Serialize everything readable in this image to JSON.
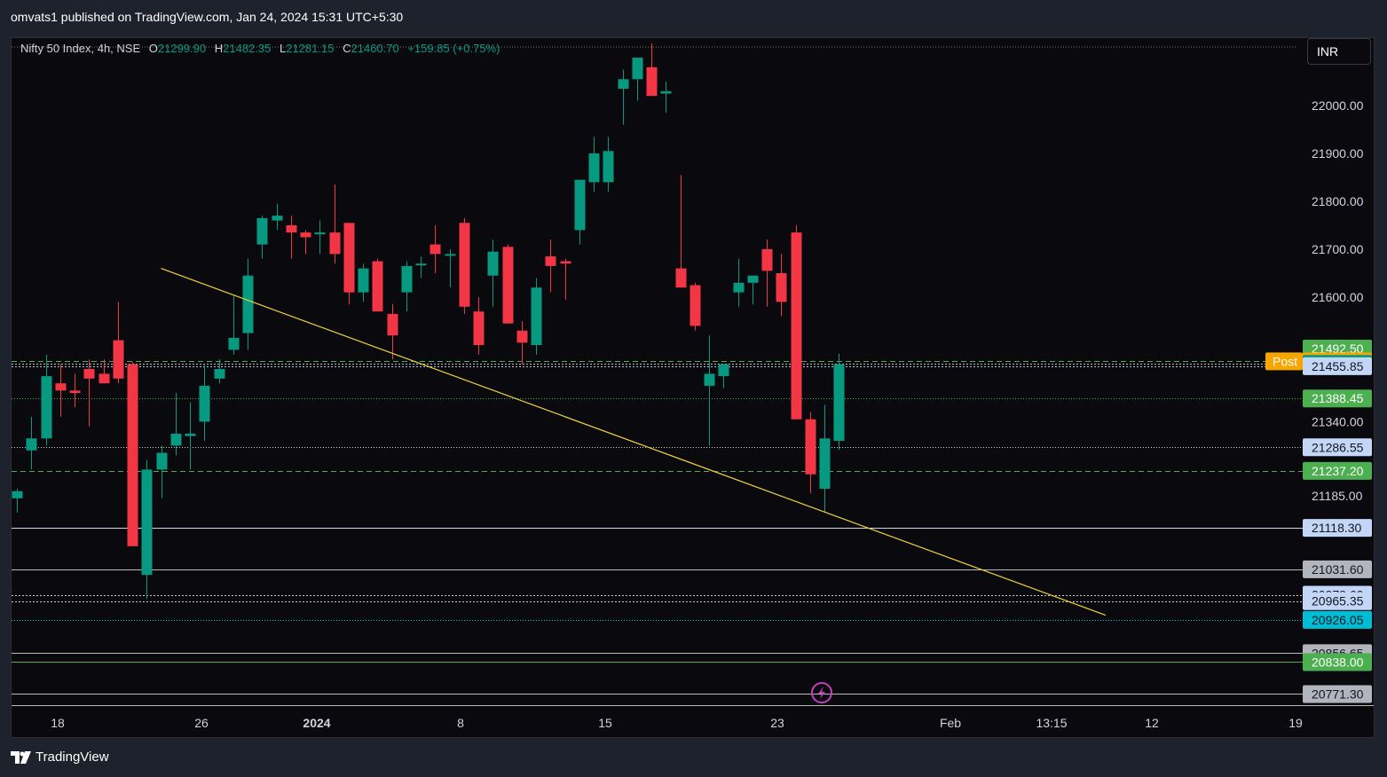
{
  "header": {
    "published_line": "omvats1 published on TradingView.com, Jan 24, 2024 15:31 UTC+5:30"
  },
  "legend": {
    "symbol": "Nifty 50 Index, 4h, NSE",
    "o_label": "O",
    "o_value": "21299.90",
    "h_label": "H",
    "h_value": "21482.35",
    "l_label": "L",
    "l_value": "21281.15",
    "c_label": "C",
    "c_value": "21460.70",
    "change": "+159.85 (+0.75%)"
  },
  "currency": "INR",
  "footer": {
    "brand": "TradingView"
  },
  "colors": {
    "up": "#089981",
    "down": "#f23645",
    "trendline": "#f0d43c",
    "background": "#0a0a0e"
  },
  "chart_data": {
    "type": "candlestick",
    "title": "Nifty 50 Index, 4h, NSE",
    "y_range": [
      20760,
      22200
    ],
    "x_tick_labels": [
      "18",
      "26",
      "2024",
      "8",
      "15",
      "23",
      "Feb",
      "13:15",
      "12",
      "19"
    ],
    "y_tick_labels": [
      22000,
      21900,
      21800,
      21700,
      21600,
      21340,
      21185
    ],
    "candles": [
      {
        "o": 21180,
        "h": 21200,
        "l": 21150,
        "c": 21195
      },
      {
        "o": 21280,
        "h": 21350,
        "l": 21240,
        "c": 21305
      },
      {
        "o": 21305,
        "h": 21480,
        "l": 21290,
        "c": 21435
      },
      {
        "o": 21420,
        "h": 21460,
        "l": 21350,
        "c": 21405
      },
      {
        "o": 21405,
        "h": 21440,
        "l": 21370,
        "c": 21400
      },
      {
        "o": 21450,
        "h": 21470,
        "l": 21330,
        "c": 21430
      },
      {
        "o": 21440,
        "h": 21470,
        "l": 21420,
        "c": 21420
      },
      {
        "o": 21510,
        "h": 21590,
        "l": 21420,
        "c": 21430
      },
      {
        "o": 21460,
        "h": 21465,
        "l": 21080,
        "c": 21080
      },
      {
        "o": 21020,
        "h": 21260,
        "l": 20970,
        "c": 21240
      },
      {
        "o": 21240,
        "h": 21290,
        "l": 21180,
        "c": 21275
      },
      {
        "o": 21290,
        "h": 21400,
        "l": 21270,
        "c": 21315
      },
      {
        "o": 21310,
        "h": 21380,
        "l": 21240,
        "c": 21315
      },
      {
        "o": 21340,
        "h": 21460,
        "l": 21300,
        "c": 21415
      },
      {
        "o": 21430,
        "h": 21470,
        "l": 21420,
        "c": 21450
      },
      {
        "o": 21490,
        "h": 21605,
        "l": 21480,
        "c": 21515
      },
      {
        "o": 21525,
        "h": 21680,
        "l": 21490,
        "c": 21645
      },
      {
        "o": 21710,
        "h": 21770,
        "l": 21680,
        "c": 21765
      },
      {
        "o": 21760,
        "h": 21795,
        "l": 21740,
        "c": 21770
      },
      {
        "o": 21750,
        "h": 21770,
        "l": 21680,
        "c": 21735
      },
      {
        "o": 21735,
        "h": 21740,
        "l": 21690,
        "c": 21725
      },
      {
        "o": 21735,
        "h": 21760,
        "l": 21690,
        "c": 21735
      },
      {
        "o": 21735,
        "h": 21835,
        "l": 21670,
        "c": 21690
      },
      {
        "o": 21755,
        "h": 21755,
        "l": 21585,
        "c": 21610
      },
      {
        "o": 21610,
        "h": 21670,
        "l": 21590,
        "c": 21660
      },
      {
        "o": 21675,
        "h": 21680,
        "l": 21580,
        "c": 21570
      },
      {
        "o": 21565,
        "h": 21585,
        "l": 21470,
        "c": 21520
      },
      {
        "o": 21610,
        "h": 21675,
        "l": 21570,
        "c": 21665
      },
      {
        "o": 21670,
        "h": 21685,
        "l": 21640,
        "c": 21670
      },
      {
        "o": 21710,
        "h": 21750,
        "l": 21650,
        "c": 21690
      },
      {
        "o": 21690,
        "h": 21700,
        "l": 21620,
        "c": 21690
      },
      {
        "o": 21755,
        "h": 21765,
        "l": 21565,
        "c": 21580
      },
      {
        "o": 21570,
        "h": 21600,
        "l": 21480,
        "c": 21500
      },
      {
        "o": 21645,
        "h": 21720,
        "l": 21580,
        "c": 21695
      },
      {
        "o": 21705,
        "h": 21710,
        "l": 21545,
        "c": 21545
      },
      {
        "o": 21530,
        "h": 21550,
        "l": 21460,
        "c": 21505
      },
      {
        "o": 21500,
        "h": 21640,
        "l": 21480,
        "c": 21620
      },
      {
        "o": 21685,
        "h": 21720,
        "l": 21610,
        "c": 21665
      },
      {
        "o": 21675,
        "h": 21680,
        "l": 21595,
        "c": 21670
      },
      {
        "o": 21740,
        "h": 21800,
        "l": 21710,
        "c": 21845
      },
      {
        "o": 21840,
        "h": 21935,
        "l": 21820,
        "c": 21900
      },
      {
        "o": 21840,
        "h": 21935,
        "l": 21820,
        "c": 21905
      },
      {
        "o": 22035,
        "h": 22075,
        "l": 21960,
        "c": 22055
      },
      {
        "o": 22055,
        "h": 22100,
        "l": 22010,
        "c": 22100
      },
      {
        "o": 22080,
        "h": 22130,
        "l": 22020,
        "c": 22020
      },
      {
        "o": 22025,
        "h": 22050,
        "l": 21985,
        "c": 22030
      },
      {
        "o": 21660,
        "h": 21855,
        "l": 21620,
        "c": 21620
      },
      {
        "o": 21625,
        "h": 21630,
        "l": 21530,
        "c": 21540
      },
      {
        "o": 21415,
        "h": 21520,
        "l": 21290,
        "c": 21440
      },
      {
        "o": 21435,
        "h": 21460,
        "l": 21410,
        "c": 21460
      },
      {
        "o": 21610,
        "h": 21680,
        "l": 21580,
        "c": 21630
      },
      {
        "o": 21630,
        "h": 21640,
        "l": 21585,
        "c": 21645
      },
      {
        "o": 21700,
        "h": 21720,
        "l": 21580,
        "c": 21655
      },
      {
        "o": 21650,
        "h": 21690,
        "l": 21560,
        "c": 21590
      },
      {
        "o": 21735,
        "h": 21750,
        "l": 21345,
        "c": 21345
      },
      {
        "o": 21345,
        "h": 21360,
        "l": 21190,
        "c": 21230
      },
      {
        "o": 21200,
        "h": 21375,
        "l": 21150,
        "c": 21305
      },
      {
        "o": 21300,
        "h": 21482,
        "l": 21281,
        "c": 21460
      }
    ],
    "trendline": {
      "from": {
        "candle": 10,
        "price": 21660
      },
      "to": {
        "candle": 75.5,
        "price": 20936
      }
    },
    "horizontal_lines": [
      {
        "price": 21465.9,
        "color": "#4caf50",
        "dash": "6,4"
      },
      {
        "price": 21460.7,
        "color": "#bbbbbb",
        "dash": "2,2"
      },
      {
        "price": 21455.85,
        "color": "#b0c4de",
        "dash": "2,2"
      },
      {
        "price": 21388.45,
        "color": "#4caf50",
        "dash": "1,2"
      },
      {
        "price": 21286.55,
        "color": "#cccccc",
        "dash": "1,2"
      },
      {
        "price": 21237.2,
        "color": "#4caf50",
        "dash": "6,4"
      },
      {
        "price": 21118.3,
        "color": "#d0d8e8",
        "dash": ""
      },
      {
        "price": 21031.6,
        "color": "#bbbbbb",
        "dash": ""
      },
      {
        "price": 20978.6,
        "color": "#cccccc",
        "dash": "2,2"
      },
      {
        "price": 20965.35,
        "color": "#cccccc",
        "dash": "2,2"
      },
      {
        "price": 20926.05,
        "color": "#26c6da",
        "dash": "1,2"
      },
      {
        "price": 20856.65,
        "color": "#bbbbbb",
        "dash": ""
      },
      {
        "price": 20838.0,
        "color": "#4caf50",
        "dash": ""
      },
      {
        "price": 20771.3,
        "color": "#bbbbbb",
        "dash": ""
      }
    ],
    "price_labels": [
      {
        "text": "21492.50",
        "price": 21492.5,
        "bg": "#4caf50",
        "fg": "#ffffff"
      },
      {
        "text": "21465.90",
        "price": 21465.9,
        "bg": "#f7a600",
        "fg": "#ffffff",
        "tag": "Post"
      },
      {
        "text": "21460.70",
        "price": 21460.7,
        "bg": "#089981",
        "fg": "#ffffff"
      },
      {
        "text": "21455.85",
        "price": 21455.85,
        "bg": "#c4d6f5",
        "fg": "#131722"
      },
      {
        "text": "21388.45",
        "price": 21388.45,
        "bg": "#4caf50",
        "fg": "#ffffff"
      },
      {
        "text": "21286.55",
        "price": 21286.55,
        "bg": "#c4d6f5",
        "fg": "#131722"
      },
      {
        "text": "21237.20",
        "price": 21237.2,
        "bg": "#4caf50",
        "fg": "#ffffff"
      },
      {
        "text": "21118.30",
        "price": 21118.3,
        "bg": "#c4d6f5",
        "fg": "#131722"
      },
      {
        "text": "21031.60",
        "price": 21031.6,
        "bg": "#b2b5be",
        "fg": "#131722"
      },
      {
        "text": "20978.60",
        "price": 20978.6,
        "bg": "#c4d6f5",
        "fg": "#131722"
      },
      {
        "text": "20965.35",
        "price": 20965.35,
        "bg": "#c4d6f5",
        "fg": "#131722"
      },
      {
        "text": "20926.05",
        "price": 20926.05,
        "bg": "#00bcd4",
        "fg": "#131722"
      },
      {
        "text": "20856.65",
        "price": 20856.65,
        "bg": "#b2b5be",
        "fg": "#131722"
      },
      {
        "text": "20838.00",
        "price": 20838.0,
        "bg": "#4caf50",
        "fg": "#ffffff"
      },
      {
        "text": "20771.30",
        "price": 20771.3,
        "bg": "#b2b5be",
        "fg": "#131722"
      }
    ]
  }
}
